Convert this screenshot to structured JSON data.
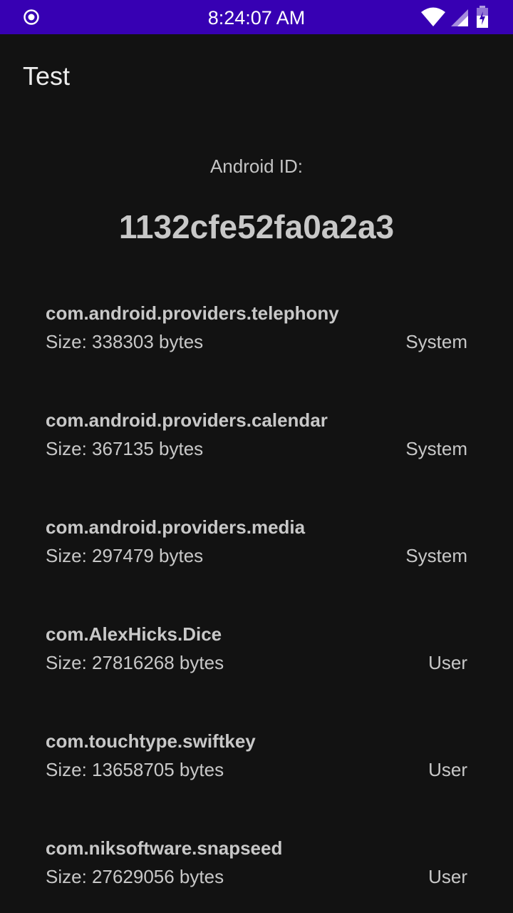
{
  "status_bar": {
    "time": "8:24:07 AM",
    "left_icon": "record-circle-icon",
    "right_icons": [
      "wifi-icon",
      "cell-signal-icon",
      "battery-charging-icon"
    ]
  },
  "app": {
    "title": "Test"
  },
  "device": {
    "id_label": "Android ID:",
    "id_value": "1132cfe52fa0a2a3"
  },
  "packages": [
    {
      "name": "com.android.providers.telephony",
      "size": "Size: 338303 bytes",
      "type": "System"
    },
    {
      "name": "com.android.providers.calendar",
      "size": "Size: 367135 bytes",
      "type": "System"
    },
    {
      "name": "com.android.providers.media",
      "size": "Size: 297479 bytes",
      "type": "System"
    },
    {
      "name": "com.AlexHicks.Dice",
      "size": "Size: 27816268 bytes",
      "type": "User"
    },
    {
      "name": "com.touchtype.swiftkey",
      "size": "Size: 13658705 bytes",
      "type": "User"
    },
    {
      "name": "com.niksoftware.snapseed",
      "size": "Size: 27629056 bytes",
      "type": "User"
    }
  ],
  "colors": {
    "status_bar": "#3700b3",
    "background": "#121212",
    "text": "#c8c8c8"
  }
}
